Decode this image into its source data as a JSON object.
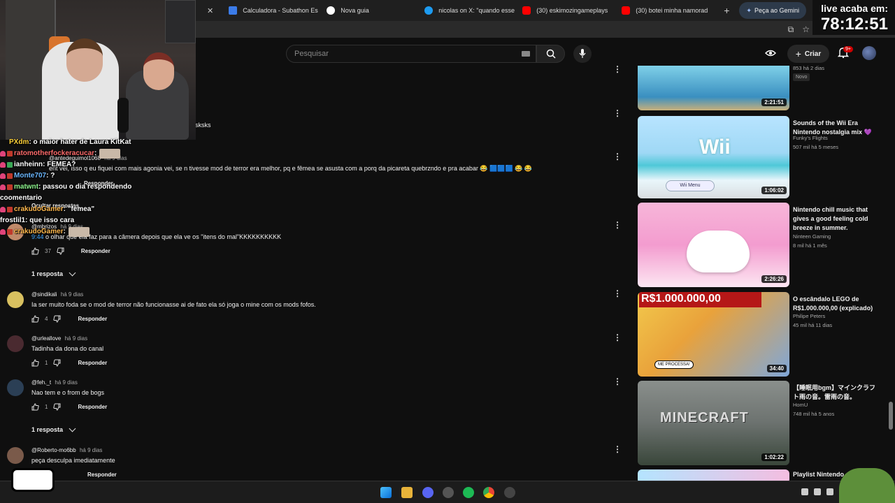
{
  "browser": {
    "tabs": [
      {
        "label": "Calculadora - Subathon Es",
        "color": "#3b7be8"
      },
      {
        "label": "Nova guia",
        "color": "#ffffff"
      },
      {
        "label": "nicolas on X: \"quando esse",
        "color": "#1d9bf0"
      },
      {
        "label": "(30) eskimozingameplays",
        "color": "#ff0000"
      },
      {
        "label": "(30) botei minha namorad",
        "color": "#ff0000"
      }
    ],
    "gemini_label": "Peça ao Gemini"
  },
  "overlay": {
    "timer_label": "live acaba em:",
    "timer_value": "78:12:51",
    "chat": [
      {
        "user": "PXdm",
        "text": "o maior hater de Laura KitKat",
        "user_color": "#ffd23a"
      },
      {
        "user": "ratomotherfockeracucar",
        "text": "",
        "user_color": "#ff6b6b"
      },
      {
        "user": "ianheinn",
        "text": "FEMEA?",
        "user_color": "#ffffff"
      },
      {
        "user": "Monte707",
        "text": "?",
        "user_color": "#6bb7ff"
      },
      {
        "user": "matwnt",
        "text": "passou o dia respondendo",
        "user_color": "#8ef58e"
      },
      {
        "user": "",
        "text": "coomentario",
        "user_color": "#ffffff"
      },
      {
        "user": "crakudoGamer",
        "text": "\"femea\"",
        "user_color": "#ffb84d"
      },
      {
        "user": "frostlil1",
        "text": "que isso cara",
        "user_color": "#ffffff"
      },
      {
        "user": "crakudoGamer",
        "text": "",
        "user_color": "#ffb84d"
      }
    ]
  },
  "masthead": {
    "search_placeholder": "Pesquisar",
    "create_label": "Criar",
    "notif_count": "9+"
  },
  "comments": {
    "partial_sksks": "sksks",
    "partial_user": "@antedeguimol1068",
    "partial_time": "há 9 dias",
    "partial_text": "ent vei, isso q eu fiquei com mais agonia vei, se n tivesse mod de terror era melhor, pq e fêmea se asusta com a porq da picareta quebrzndo e pra acabar 😂 🟦🟦🟦 😂 😂",
    "partial_reply": "Responder",
    "partial_hide_replies": "Ocultar respostas",
    "reply_user": "@mbrizos",
    "reply_time": "há 9 dias",
    "reply_timestamp": "9:44",
    "reply_text": "o olhar que ela faz para a câmera depois que ela ve os \"itens do mal\"KKKKKKKKKK",
    "reply_likes": "37",
    "reply_label": "Responder",
    "toggle_1": "1 resposta",
    "items": [
      {
        "user": "@sindikali",
        "time": "há 9 dias",
        "text": "Ia ser muito foda se o mod de terror não funcionasse ai de fato ela só joga o mine com os mods fofos.",
        "likes": "4",
        "reply": "Responder"
      },
      {
        "user": "@urleallove",
        "time": "há 9 dias",
        "text": "Tadinha da dona do canal",
        "likes": "1",
        "reply": "Responder"
      },
      {
        "user": "@feh._t",
        "time": "há 9 dias",
        "text": "Nao tem e o from de bogs",
        "likes": "1",
        "reply": "Responder"
      },
      {
        "user": "@Roberto-mo6bb",
        "time": "há 9 dias",
        "text": "peça desculpa imediatamente",
        "likes": "",
        "reply": "Responder"
      }
    ],
    "toggle_2": "1 resposta"
  },
  "recommendations": [
    {
      "title": "",
      "channel": "",
      "meta": "853  há 2 dias",
      "duration": "2:21:51",
      "badge": "Novo"
    },
    {
      "title": "Sounds of the Wii Era Nintendo nostalgia mix 💜",
      "channel": "Funky's Flights",
      "meta": "507 mil  há 5 meses",
      "duration": "1:06:02",
      "thumb_text": "Wii",
      "thumb_menu": "Wii Menu"
    },
    {
      "title": "Nintendo chill music that gives a good feeling cold breeze in summer.",
      "channel": "Ninteen Gaming",
      "meta": "8 mil  há 1 mês",
      "duration": "2:26:26"
    },
    {
      "title": "O escândalo LEGO de R$1.000.000,00 (explicado)",
      "channel": "Philipe Peters",
      "meta": "45 mil  há 11 dias",
      "duration": "34:40",
      "thumb_text": "R$1.000.000,00",
      "thumb_sub": "ME PROCESSA!"
    },
    {
      "title": "【睡眠用bgm】マインクラフト雨の音。雷雨の音。",
      "channel": "HomU",
      "meta": "748 mil  há 5 anos",
      "duration": "1:02:22",
      "thumb_text": "MINECRAFT"
    },
    {
      "title": "Playlist Nintendo chill music",
      "channel": "",
      "meta": "",
      "duration": ""
    }
  ]
}
